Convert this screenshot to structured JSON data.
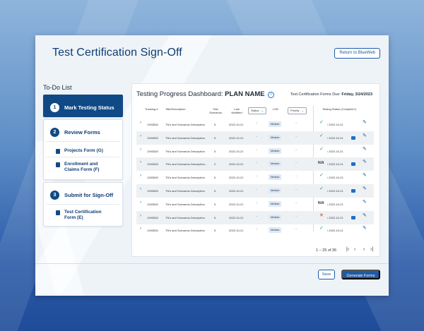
{
  "window": {
    "title": "Test Certification Sign-Off",
    "return_button": "Return to BlueWeb"
  },
  "todo": {
    "heading": "To-Do List",
    "steps": [
      {
        "number": "1",
        "label": "Mark Testing Status",
        "active": true,
        "items": []
      },
      {
        "number": "2",
        "label": "Review Forms",
        "active": false,
        "items": [
          "Projects Form (G)",
          "Enrollment and Claims Form (F)"
        ]
      },
      {
        "number": "3",
        "label": "Submit for Sign-Off",
        "active": false,
        "items": [
          "Test Certification Form (E)"
        ]
      }
    ]
  },
  "dashboard": {
    "title_prefix": "Testing Progress Dashboard:",
    "plan_name": "PLAN NAME",
    "info_icon": "i",
    "due_label": "Test Certification Forms Due:",
    "due_date": "Friday, 3/24/2023",
    "columns": {
      "tracking": "Tracking #",
      "title": "Title/Description",
      "scenarios": "Test Scenarios",
      "modified": "Last Modified",
      "status": "Status",
      "loe": "LOE",
      "priority": "Priority",
      "testing_status": "Testing Status (Complete?)"
    },
    "rows": [
      {
        "tracking": "1393528",
        "title": "TN's and Scenarios Description",
        "scenarios": "5",
        "modified": "2022-10-21",
        "loe": "Medium",
        "status_icon": "check",
        "status_text": "/ 2022-10-21",
        "comment": false
      },
      {
        "tracking": "1393528",
        "title": "TN's and Scenarios Description",
        "scenarios": "5",
        "modified": "2022-10-21",
        "loe": "Medium",
        "status_icon": "check",
        "status_text": "/ 2022-10-21",
        "comment": true
      },
      {
        "tracking": "1393528",
        "title": "TN's and Scenarios Description",
        "scenarios": "5",
        "modified": "2022-10-21",
        "loe": "Medium",
        "status_icon": "check",
        "status_text": "/ 2022-10-21",
        "comment": false
      },
      {
        "tracking": "1393528",
        "title": "TN's and Scenarios Description...",
        "scenarios": "2",
        "modified": "2022-10-21",
        "loe": "Medium",
        "status_icon": "na",
        "status_text": "/ 2022-10-21",
        "comment": true
      },
      {
        "tracking": "1393528",
        "title": "TN's and Scenarios Description",
        "scenarios": "5",
        "modified": "2022-10-21",
        "loe": "Medium",
        "status_icon": "check",
        "status_text": "/ 2022-10-21",
        "comment": false
      },
      {
        "tracking": "1393528",
        "title": "TN's and Scenarios Description",
        "scenarios": "5",
        "modified": "2022-10-21",
        "loe": "Medium",
        "status_icon": "check",
        "status_text": "/ 2022-10-21",
        "comment": true
      },
      {
        "tracking": "1393528",
        "title": "TN's and Scenarios Description",
        "scenarios": "5",
        "modified": "2022-10-21",
        "loe": "Medium",
        "status_icon": "na",
        "status_text": "/ 2022-10-21",
        "comment": false
      },
      {
        "tracking": "1393528",
        "title": "TN's and Scenarios Description",
        "scenarios": "5",
        "modified": "2022-10-21",
        "loe": "Medium",
        "status_icon": "x",
        "status_text": "/ 2022-10-21",
        "comment": true
      },
      {
        "tracking": "1393528",
        "title": "TN's and Scenarios Description",
        "scenarios": "5",
        "modified": "2022-10-21",
        "loe": "Medium",
        "status_icon": "check",
        "status_text": "/ 2022-10-21",
        "comment": false
      }
    ],
    "na_label": "N/A",
    "pager": "1 – 25 of 36"
  },
  "footer": {
    "save": "Save",
    "generate": "Generate Forms"
  },
  "colors": {
    "primary": "#1f5aa3",
    "active_step": "#0f4a86",
    "complete": "#2c9a4a",
    "rejected": "#d0362b"
  }
}
